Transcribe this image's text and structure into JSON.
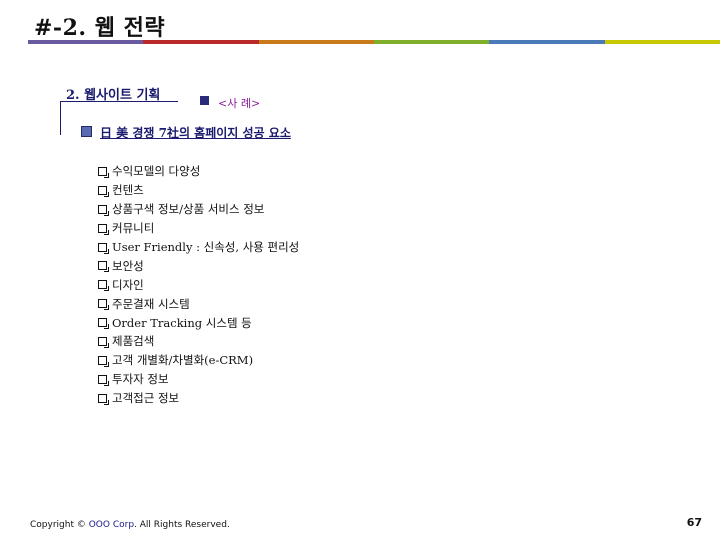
{
  "title": "#-2. 웹 전략",
  "rule_colors": [
    "#6a5aa0",
    "#b82a2a",
    "#c87a1a",
    "#7fae2a",
    "#4a7ab8",
    "#c8c800"
  ],
  "section_label": "2. 웹사이트 기획",
  "example_label": "<사 례>",
  "heading": "日 美 경쟁 7社의 홈페이지 성공 요소",
  "items": [
    "수익모델의 다양성",
    "컨텐츠",
    "상품구색 정보/상품 서비스 정보",
    "커뮤니티",
    "User Friendly : 신속성, 사용 편리성",
    "보안성",
    "디자인",
    "주문결재 시스템",
    "Order Tracking 시스템 등",
    "제품검색",
    "고객 개별화/차별화(e-CRM)",
    "투자자 정보",
    "고객접근 정보"
  ],
  "footer": {
    "copyright_prefix": "Copyright ©",
    "brand": "OOO Corp",
    "suffix": ". All Rights Reserved."
  },
  "page_number": "67"
}
